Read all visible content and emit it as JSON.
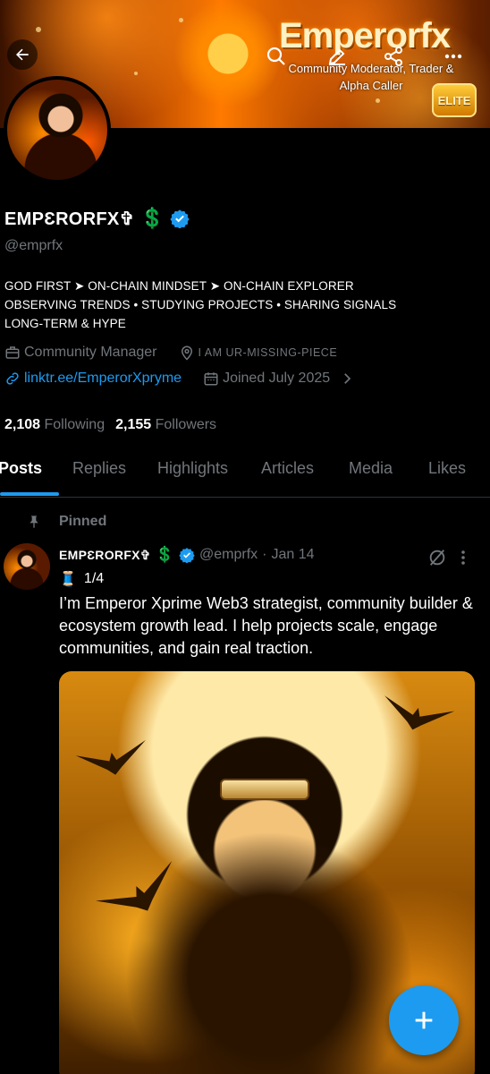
{
  "banner": {
    "title": "Emperorfx",
    "subtitle_line1": "Community Moderator, Trader &",
    "subtitle_line2": "Alpha Caller",
    "badge": "ELITE"
  },
  "profile": {
    "display_name": "EMPƐRORFX✞",
    "dollar_emoji": "💲",
    "handle": "@emprfx",
    "bio": [
      "GOD FIRST ➤ ON-CHAIN MINDSET ➤ ON-CHAIN EXPLORER",
      "OBSERVING TRENDS • STUDYING PROJECTS • SHARING SIGNALS",
      "LONG-TERM & HYPE"
    ],
    "category": "Community Manager",
    "location": "I AM UR-MISSING-PIECE",
    "link": "linktr.ee/EmperorXpryme",
    "joined": "Joined July 2025",
    "following_count": "2,108",
    "following_label": "Following",
    "followers_count": "2,155",
    "followers_label": "Followers"
  },
  "tabs": [
    "Posts",
    "Replies",
    "Highlights",
    "Articles",
    "Media",
    "Likes"
  ],
  "active_tab": "Posts",
  "pinned_post": {
    "pinned_label": "Pinned",
    "author_name": "EMPƐRORFX✞",
    "dollar_emoji": "💲",
    "author_handle": "@emprfx",
    "separator": "·",
    "date": "Jan 14",
    "thread_marker": "🧵",
    "thread_count": "1/4",
    "text": "I’m Emperor Xprime  Web3 strategist, community builder & ecosystem growth lead. I help projects scale, engage communities, and gain real traction."
  },
  "colors": {
    "accent": "#1d9bf0",
    "muted": "#71767b",
    "background": "#000000",
    "dollar": "#1fb850"
  },
  "icons": [
    "back-arrow-icon",
    "search-icon",
    "edit-icon",
    "share-icon",
    "more-icon",
    "verified-badge-icon",
    "briefcase-icon",
    "location-pin-icon",
    "link-icon",
    "calendar-icon",
    "chevron-right-icon",
    "pin-icon",
    "grok-icon",
    "post-more-icon",
    "compose-plus-icon"
  ]
}
